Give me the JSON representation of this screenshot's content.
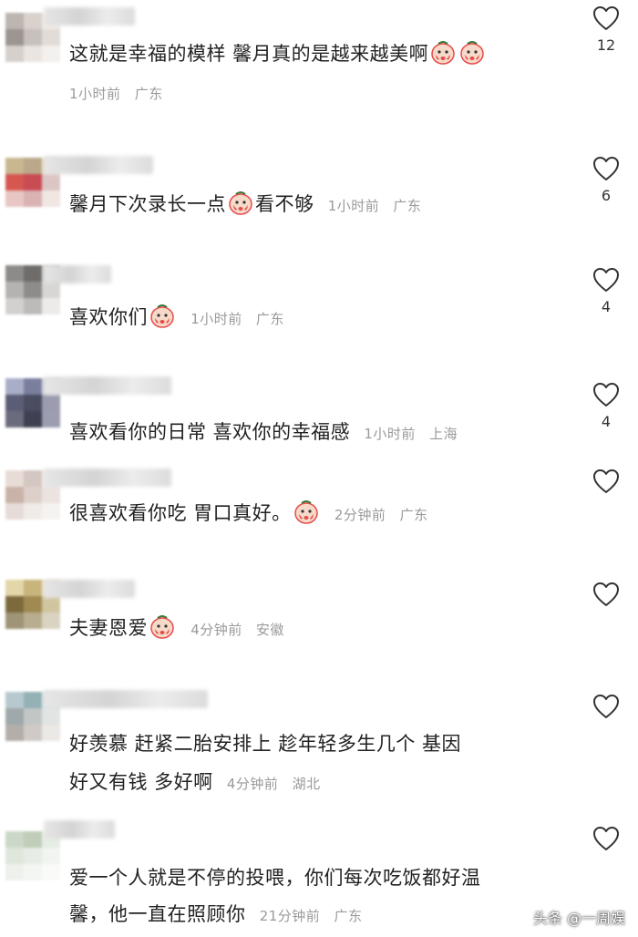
{
  "comments": [
    {
      "text": "这就是幸福的模样 馨月真的是越来越美啊",
      "emojis_after": 2,
      "time": "1小时前",
      "location": "广东",
      "meta_newline": true,
      "likes": "12",
      "avatar_colors": [
        "#bdb5b0",
        "#d8d1cc",
        "#eeeae6",
        "#9c9591",
        "#c7c0bb",
        "#e2dcd8",
        "#d6d0cc",
        "#eae5e1",
        "#f3f0ed"
      ]
    },
    {
      "text": "馨月下次录长一点",
      "emoji_mid": true,
      "text_after": "看不够",
      "time": "1小时前",
      "location": "广东",
      "likes": "6",
      "avatar_colors": [
        "#c9b790",
        "#bba88a",
        "#e5dcc8",
        "#d6574f",
        "#c94c55",
        "#dcc5c5",
        "#e7c6c4",
        "#d9b2b4",
        "#f0e6e2"
      ]
    },
    {
      "text": "喜欢你们",
      "emojis_after": 1,
      "time": "1小时前",
      "location": "广东",
      "likes": "4",
      "avatar_colors": [
        "#8d8b89",
        "#6f6c69",
        "#c9c7c5",
        "#b5b3b1",
        "#8e8c8a",
        "#d8d6d4",
        "#d3d1cf",
        "#bdbbb9",
        "#ecebea"
      ]
    },
    {
      "text": "喜欢看你的日常 喜欢你的幸福感",
      "emojis_after": 0,
      "time": "1小时前",
      "location": "上海",
      "likes": "4",
      "avatar_colors": [
        "#a9aec8",
        "#7a7f9e",
        "#c9cbd9",
        "#5a5d75",
        "#4a4c60",
        "#9b9cb0",
        "#6a6b7c",
        "#3f4052",
        "#9c9db0"
      ]
    },
    {
      "text": "很喜欢看你吃 胃口真好。",
      "emojis_after": 1,
      "time": "2分钟前",
      "location": "广东",
      "likes": "",
      "avatar_colors": [
        "#e8dcd6",
        "#d4c6c0",
        "#f2ece8",
        "#c9b3a9",
        "#ddd0ca",
        "#ebe3df",
        "#e6dcd7",
        "#f1ebe8",
        "#f6f2f0"
      ]
    },
    {
      "text": "夫妻恩爱",
      "emojis_after": 1,
      "time": "4分钟前",
      "location": "安徽",
      "likes": "",
      "avatar_colors": [
        "#e3d6a8",
        "#c8b57c",
        "#e9e0c4",
        "#7d6a3c",
        "#a08a52",
        "#d1c59f",
        "#9f9478",
        "#b8ad8e",
        "#d9d3c1"
      ]
    },
    {
      "text": "好羡慕  赶紧二胎安排上  趁年轻多生几个  基因",
      "text2": "好又有钱  多好啊",
      "emojis_after": 0,
      "time": "4分钟前",
      "location": "湖北",
      "likes": "",
      "avatar_colors": [
        "#b7c9cf",
        "#94b1b6",
        "#d5e0e2",
        "#9fa8aa",
        "#c2c7c6",
        "#e0e4e3",
        "#b3aeaa",
        "#cfcac6",
        "#ebe8e6"
      ]
    },
    {
      "text": "爱一个人就是不停的投喂，你们每次吃饭都好温",
      "text2": "馨，他一直在照顾你",
      "emojis_after": 0,
      "time": "21分钟前",
      "location": "广东",
      "likes": "",
      "avatar_colors": [
        "#cbd8c7",
        "#bfcdb9",
        "#e6ede4",
        "#dfe6dc",
        "#e8ece6",
        "#f1f4ef",
        "#eef1ec",
        "#f4f6f3",
        "#fafbf9"
      ]
    }
  ],
  "watermark": "头条 @一周娱",
  "colors": {
    "meta_gray": "#9a9a9a",
    "emoji_red": "#e84a4a",
    "emoji_face": "#f6d9c9"
  }
}
